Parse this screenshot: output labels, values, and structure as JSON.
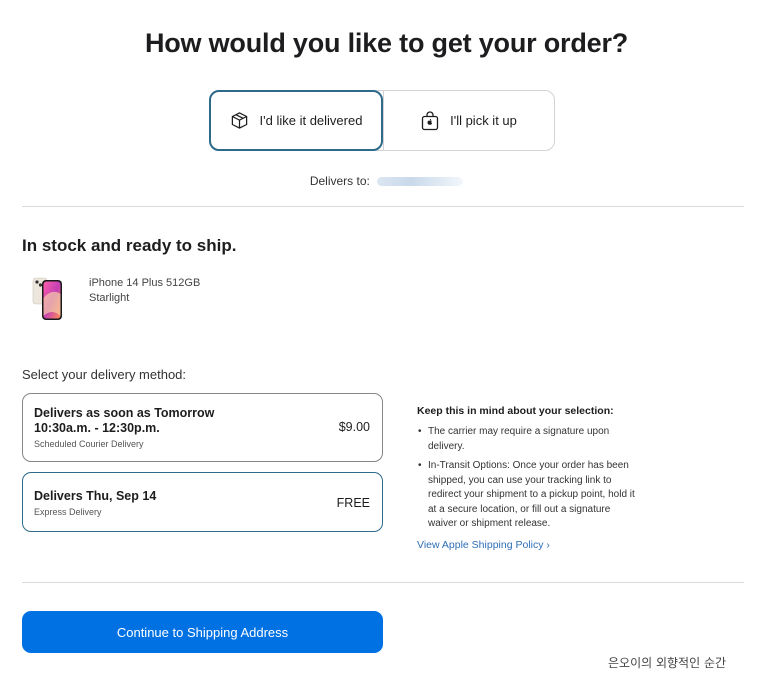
{
  "headline": "How would you like to get your order?",
  "fulfillment": {
    "delivered_label": "I'd like it delivered",
    "pickup_label": "I'll pick it up",
    "selected": "delivered"
  },
  "delivers_to_label": "Delivers to:",
  "stock_title": "In stock and ready to ship.",
  "product": {
    "name": "iPhone 14 Plus 512GB",
    "color": "Starlight"
  },
  "delivery_method_label": "Select your delivery method:",
  "delivery_options": [
    {
      "title_line1": "Delivers as soon as Tomorrow",
      "title_line2": "10:30a.m. - 12:30p.m.",
      "subtitle": "Scheduled Courier Delivery",
      "price": "$9.00"
    },
    {
      "title_line1": "Delivers Thu, Sep 14",
      "subtitle": "Express Delivery",
      "price": "FREE"
    }
  ],
  "notes": {
    "title": "Keep this in mind about your selection:",
    "items": [
      "The carrier may require a signature upon delivery.",
      "In-Transit Options: Once your order has been shipped, you can use your tracking link to redirect your shipment to a pickup point, hold it at a secure location, or fill out a signature waiver or shipment release."
    ],
    "link": "View Apple Shipping Policy ›"
  },
  "cta_label": "Continue to Shipping Address",
  "watermark": "은오이의 외향적인 순간",
  "colors": {
    "accent_blue": "#0071e3",
    "selected_border": "#2e6b8a",
    "link": "#2f6fb6",
    "divider": "#d9d9dd"
  },
  "icons": {
    "delivered": "box-icon",
    "pickup": "shopping-bag-icon",
    "chevron": "chevron-right-icon"
  }
}
